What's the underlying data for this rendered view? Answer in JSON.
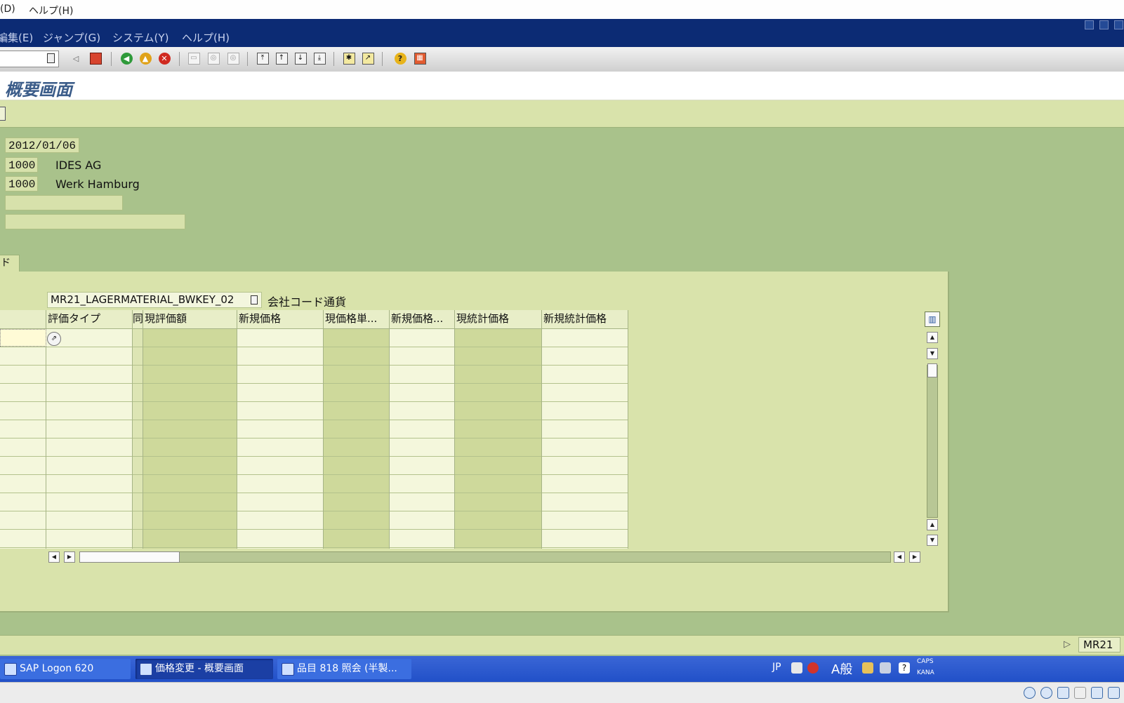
{
  "outer_menu": {
    "items": [
      "(D)",
      "ヘルプ(H)"
    ]
  },
  "sap_menu": {
    "items": [
      "編集(E)",
      "ジャンプ(G)",
      "システム(Y)",
      "ヘルプ(H)"
    ]
  },
  "toolbar": {
    "icons": [
      "back-nav-icon",
      "save-icon",
      "back-icon",
      "exit-icon",
      "cancel-icon",
      "print-icon",
      "find-icon",
      "find-next-icon",
      "first-page-icon",
      "previous-page-icon",
      "next-page-icon",
      "last-page-icon",
      "new-session-icon",
      "shortcut-icon",
      "help-icon",
      "customize-layout-icon"
    ]
  },
  "title": {
    "text": "概要画面"
  },
  "header": {
    "date": "2012/01/06",
    "company_code": "1000",
    "company_name": "IDES AG",
    "plant_code": "1000",
    "plant_name": "Werk Hamburg",
    "field4_value": "",
    "field5_value": ""
  },
  "tab": {
    "label": "ド"
  },
  "layout": {
    "value": "MR21_LAGERMATERIAL_BWKEY_02",
    "currency_label": "会社コード通貨"
  },
  "table": {
    "columns": [
      "",
      "評価タイプ",
      "同",
      "現評価額",
      "新規価格",
      "現価格単...",
      "新規価格...",
      "現統計価格",
      "新規統計価格"
    ],
    "rows": [
      [
        "",
        "",
        "",
        "",
        "",
        "",
        "",
        "",
        ""
      ],
      [
        "",
        "",
        "",
        "",
        "",
        "",
        "",
        "",
        ""
      ],
      [
        "",
        "",
        "",
        "",
        "",
        "",
        "",
        "",
        ""
      ],
      [
        "",
        "",
        "",
        "",
        "",
        "",
        "",
        "",
        ""
      ],
      [
        "",
        "",
        "",
        "",
        "",
        "",
        "",
        "",
        ""
      ],
      [
        "",
        "",
        "",
        "",
        "",
        "",
        "",
        "",
        ""
      ],
      [
        "",
        "",
        "",
        "",
        "",
        "",
        "",
        "",
        ""
      ],
      [
        "",
        "",
        "",
        "",
        "",
        "",
        "",
        "",
        ""
      ],
      [
        "",
        "",
        "",
        "",
        "",
        "",
        "",
        "",
        ""
      ],
      [
        "",
        "",
        "",
        "",
        "",
        "",
        "",
        "",
        ""
      ],
      [
        "",
        "",
        "",
        "",
        "",
        "",
        "",
        "",
        ""
      ],
      [
        "",
        "",
        "",
        "",
        "",
        "",
        "",
        "",
        ""
      ]
    ]
  },
  "status_bar": {
    "transaction": "MR21"
  },
  "taskbar": {
    "tasks": [
      "SAP Logon 620",
      "価格変更 - 概要画面",
      "品目 818 照会 (半製..."
    ],
    "tray_lang": "JP",
    "tray_ime": "A般",
    "tray_caps": "CAPS",
    "tray_kana": "KANA"
  }
}
